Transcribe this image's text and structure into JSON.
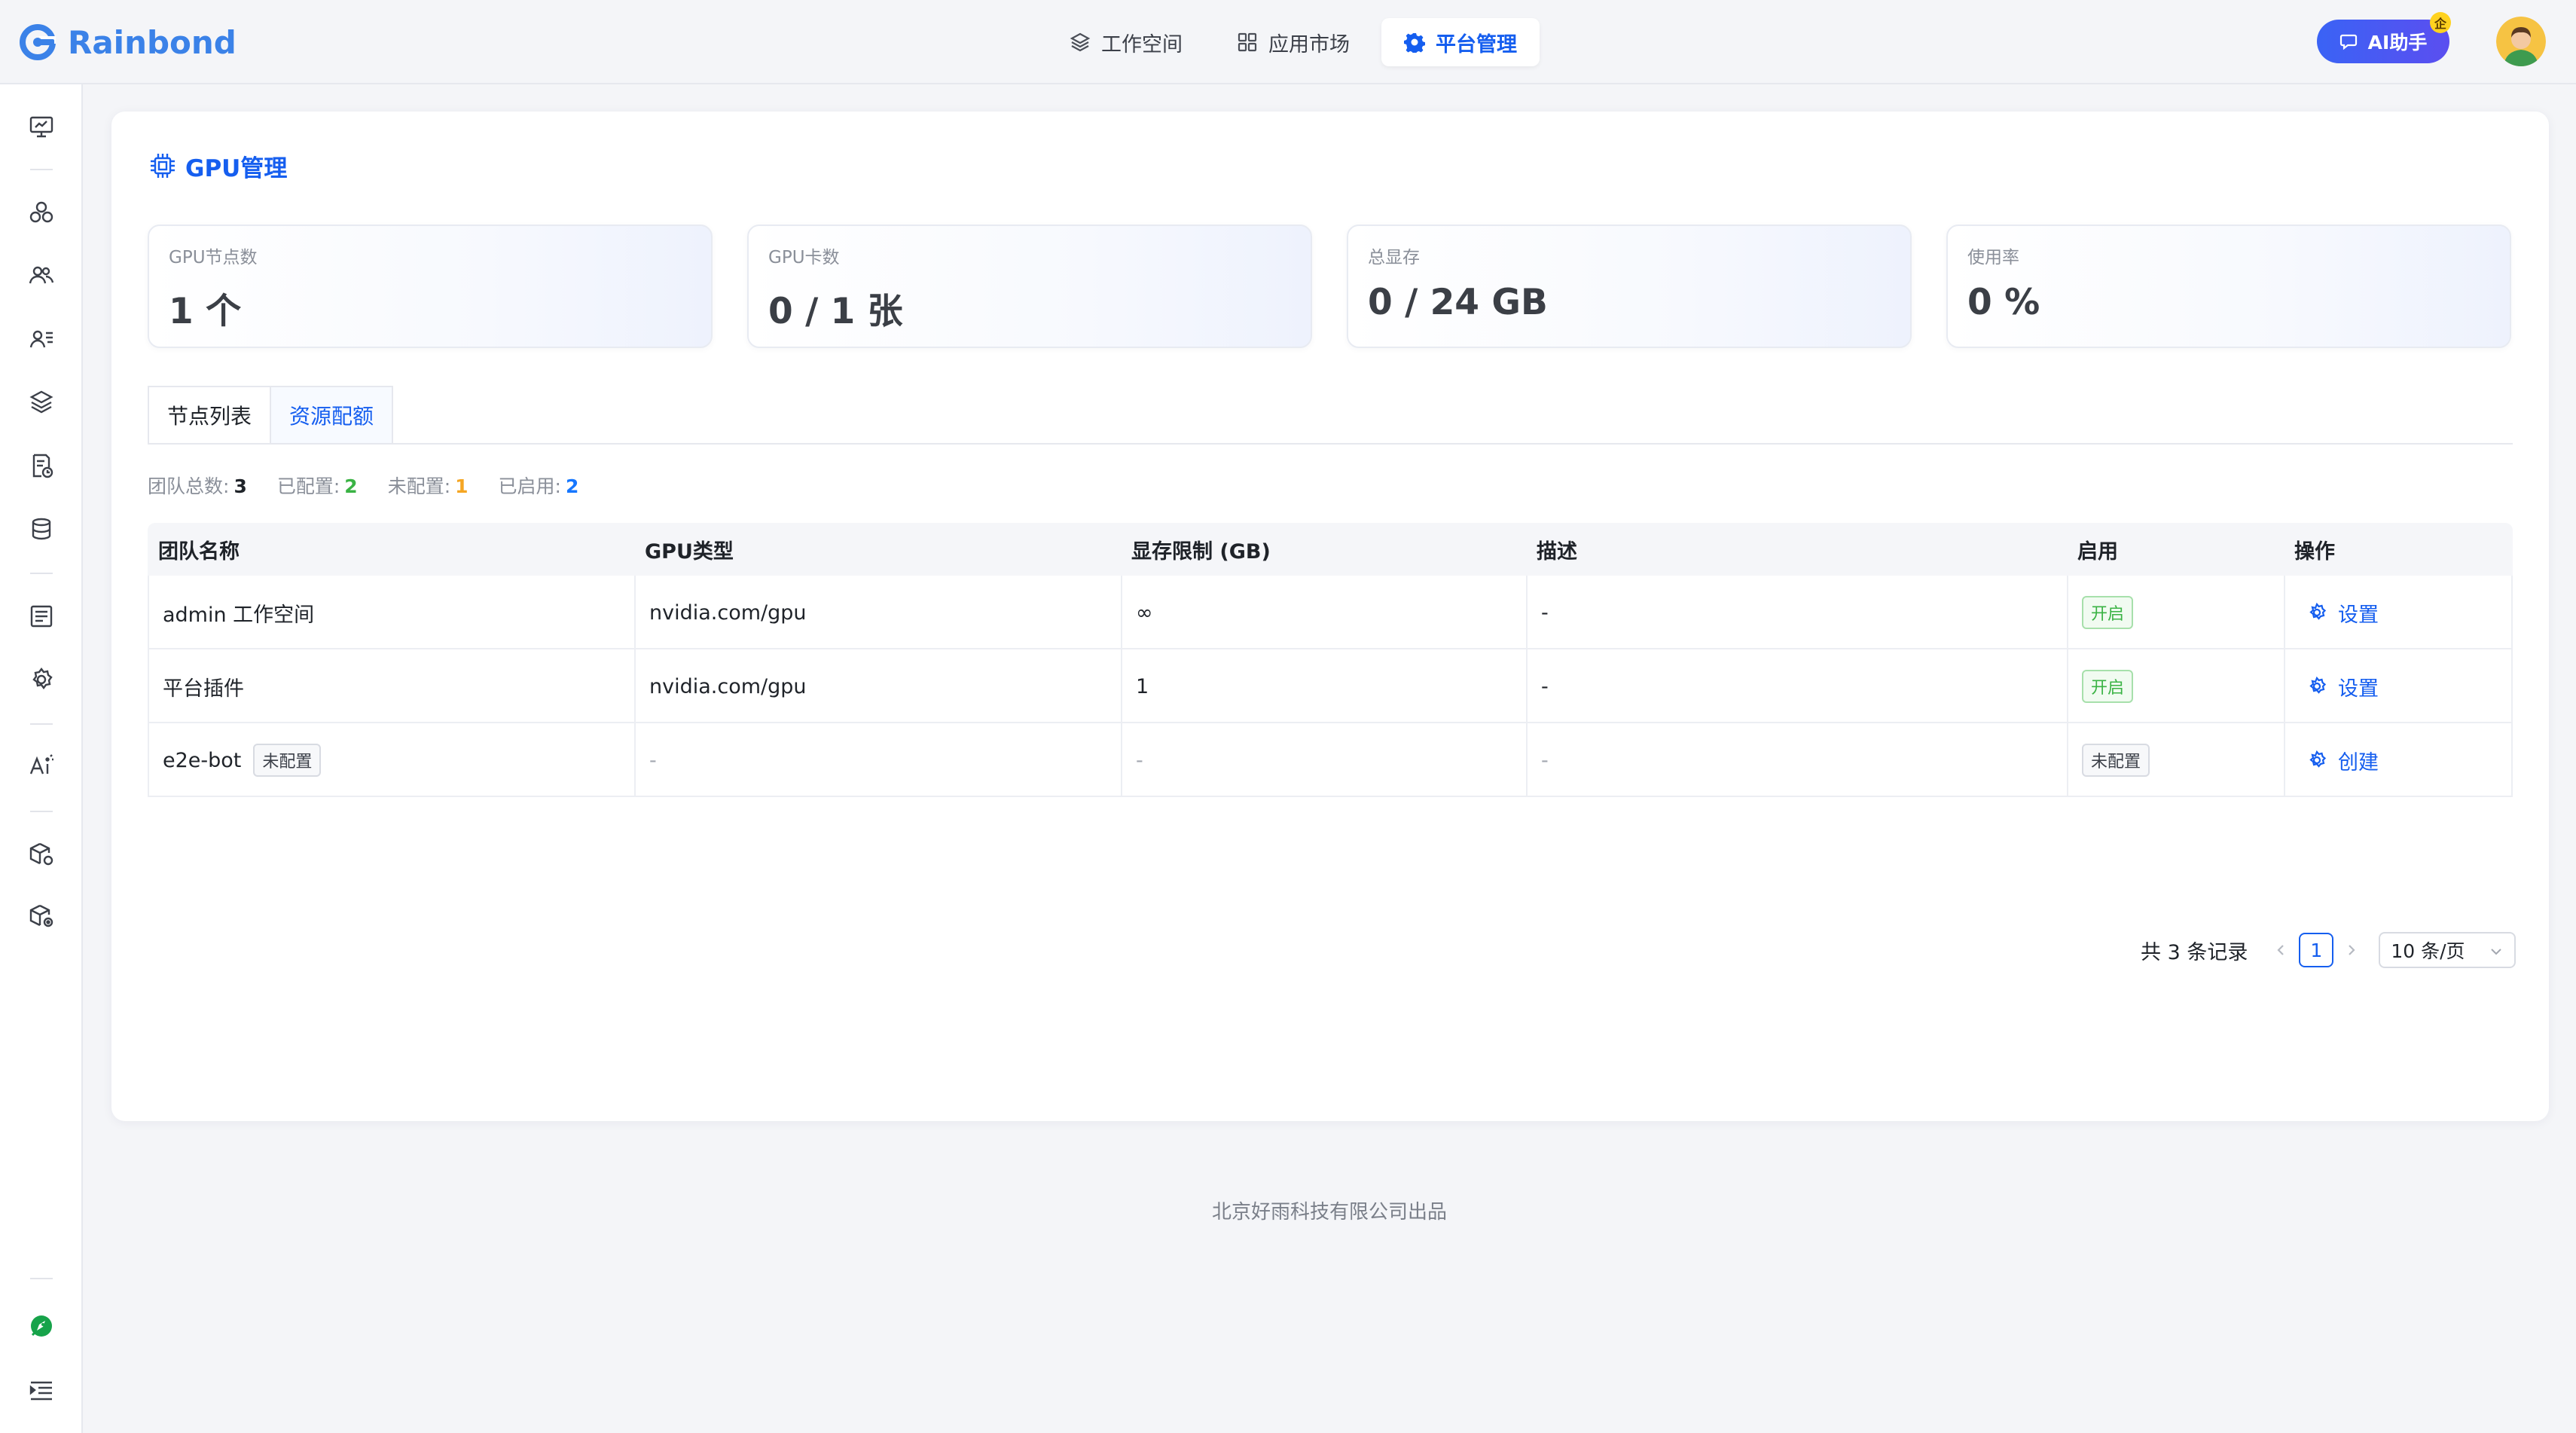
{
  "brand": {
    "name": "Rainbond",
    "color": "#3b82e8"
  },
  "topnav": [
    {
      "label": "工作空间",
      "icon": "layers-icon",
      "active": false
    },
    {
      "label": "应用市场",
      "icon": "grid-icon",
      "active": false
    },
    {
      "label": "平台管理",
      "icon": "gear-icon",
      "active": true
    }
  ],
  "ai_assistant": {
    "label": "AI助手",
    "badge": "企"
  },
  "sidebar": {
    "icons": [
      "monitor-icon",
      "cluster-icon",
      "team-icon",
      "user-card-icon",
      "layers-stack-icon",
      "document-clock-icon",
      "database-icon",
      "list-icon",
      "gear-icon",
      "ai-icon",
      "box-gear-icon",
      "box-settings-icon",
      "rocket-icon",
      "menu-indent-icon"
    ]
  },
  "page": {
    "title": "GPU管理"
  },
  "stats": [
    {
      "label": "GPU节点数",
      "value": "1 个"
    },
    {
      "label": "GPU卡数",
      "value": "0 / 1 张"
    },
    {
      "label": "总显存",
      "value": "0 / 24 GB"
    },
    {
      "label": "使用率",
      "value": "0 %"
    }
  ],
  "tabs": [
    {
      "label": "节点列表",
      "active": false
    },
    {
      "label": "资源配额",
      "active": true
    }
  ],
  "summary": {
    "total_label": "团队总数:",
    "total": "3",
    "configured_label": "已配置:",
    "configured": "2",
    "unconfigured_label": "未配置:",
    "unconfigured": "1",
    "enabled_label": "已启用:",
    "enabled": "2",
    "colors": {
      "total": "#1f2329",
      "configured": "#3ab344",
      "unconfigured": "#f5a623",
      "enabled": "#1677ff"
    }
  },
  "table": {
    "headers": [
      "团队名称",
      "GPU类型",
      "显存限制 (GB)",
      "描述",
      "启用",
      "操作"
    ],
    "rows": [
      {
        "team": "admin 工作空间",
        "team_tag": "",
        "gpu_type": "nvidia.com/gpu",
        "mem_limit": "∞",
        "desc": "-",
        "status": "开启",
        "action": "设置"
      },
      {
        "team": "平台插件",
        "team_tag": "",
        "gpu_type": "nvidia.com/gpu",
        "mem_limit": "1",
        "desc": "-",
        "status": "开启",
        "action": "设置"
      },
      {
        "team": "e2e-bot",
        "team_tag": "未配置",
        "gpu_type": "-",
        "mem_limit": "-",
        "desc": "-",
        "status": "未配置",
        "action": "创建"
      }
    ]
  },
  "pagination": {
    "total_text": "共 3 条记录",
    "current_page": "1",
    "page_size": "10 条/页"
  },
  "footer": {
    "text": "北京好雨科技有限公司出品"
  }
}
